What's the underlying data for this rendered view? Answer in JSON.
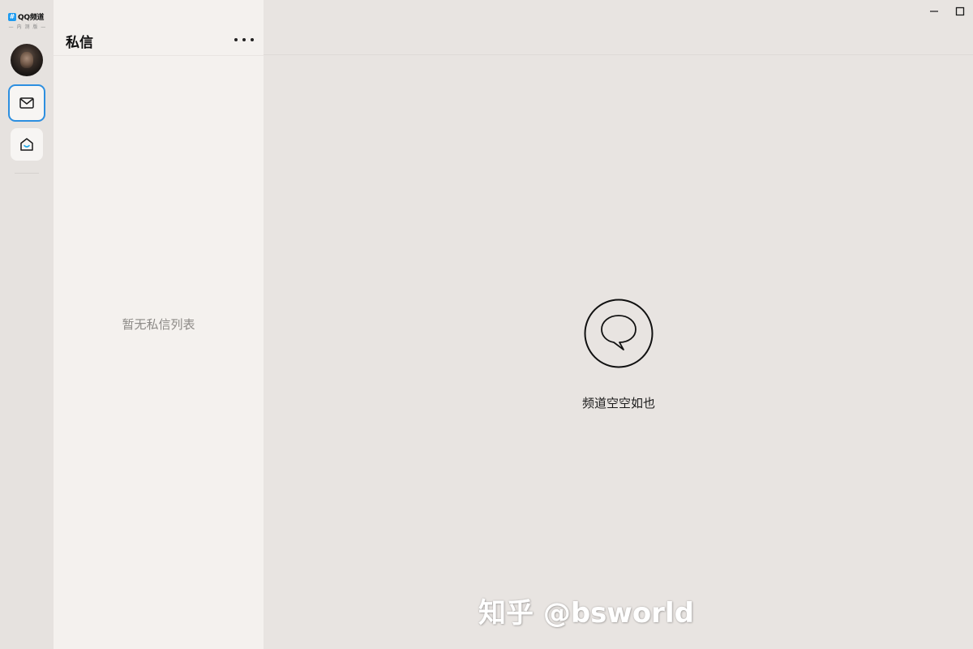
{
  "app": {
    "logo_badge": "#",
    "logo_name": "QQ频道",
    "logo_sub": "— 内 测 版 —"
  },
  "rail": {
    "items": [
      {
        "name": "avatar"
      },
      {
        "name": "mail",
        "icon": "mail-icon",
        "selected": true
      },
      {
        "name": "home",
        "icon": "home-icon"
      }
    ]
  },
  "dm_panel": {
    "title": "私信",
    "more_icon": "more-horizontal-icon",
    "empty_text": "暂无私信列表"
  },
  "main": {
    "empty_icon": "chat-bubble-icon",
    "empty_text": "频道空空如也"
  },
  "window_controls": {
    "minimize_icon": "minimize-icon",
    "maximize_icon": "maximize-icon"
  },
  "watermark": "知乎 @bsworld",
  "colors": {
    "accent": "#2d8fe0",
    "rail_bg": "#e6e2df",
    "panel_bg": "#f4f1ee",
    "main_bg": "#e8e4e1"
  }
}
